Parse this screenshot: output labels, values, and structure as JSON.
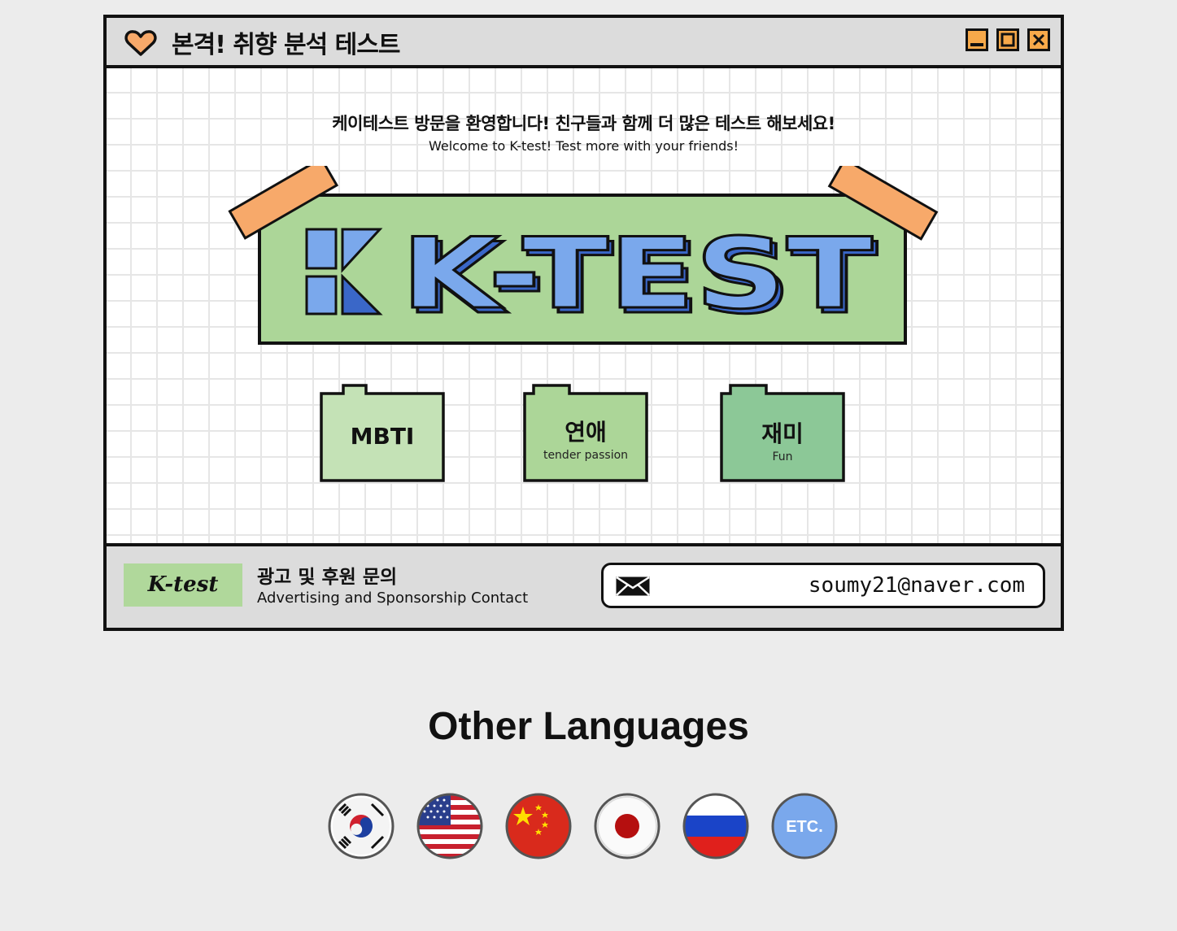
{
  "window": {
    "title": "본격! 취향 분석 테스트",
    "controls": [
      "minimize-icon",
      "maximize-icon",
      "close-icon"
    ]
  },
  "welcome": {
    "korean": "케이테스트 방문을 환영합니다! 친구들과 함께 더 많은 테스트 해보세요!",
    "english": "Welcome to K-test! Test more with your friends!"
  },
  "logo": {
    "text": "K-TEST"
  },
  "categories": [
    {
      "title": "MBTI",
      "subtitle": ""
    },
    {
      "title": "연애",
      "subtitle": "tender passion"
    },
    {
      "title": "재미",
      "subtitle": "Fun"
    }
  ],
  "footer": {
    "logo": "K-test",
    "contact_ko": "광고 및 후원 문의",
    "contact_en": "Advertising and Sponsorship Contact",
    "email": "soumy21@naver.com"
  },
  "languages": {
    "title": "Other Languages",
    "flags": [
      "korea-flag",
      "usa-flag",
      "china-flag",
      "japan-flag",
      "russia-flag",
      "etc"
    ],
    "etc_label": "ETC."
  },
  "colors": {
    "background": "#ececec",
    "logo_green": "#acd698",
    "logo_blue": "#7aa8ec",
    "tape_orange": "#f7a96a",
    "folder_light": "#c4e2b6",
    "folder_mid": "#acd698",
    "folder_dark": "#8cc897"
  }
}
